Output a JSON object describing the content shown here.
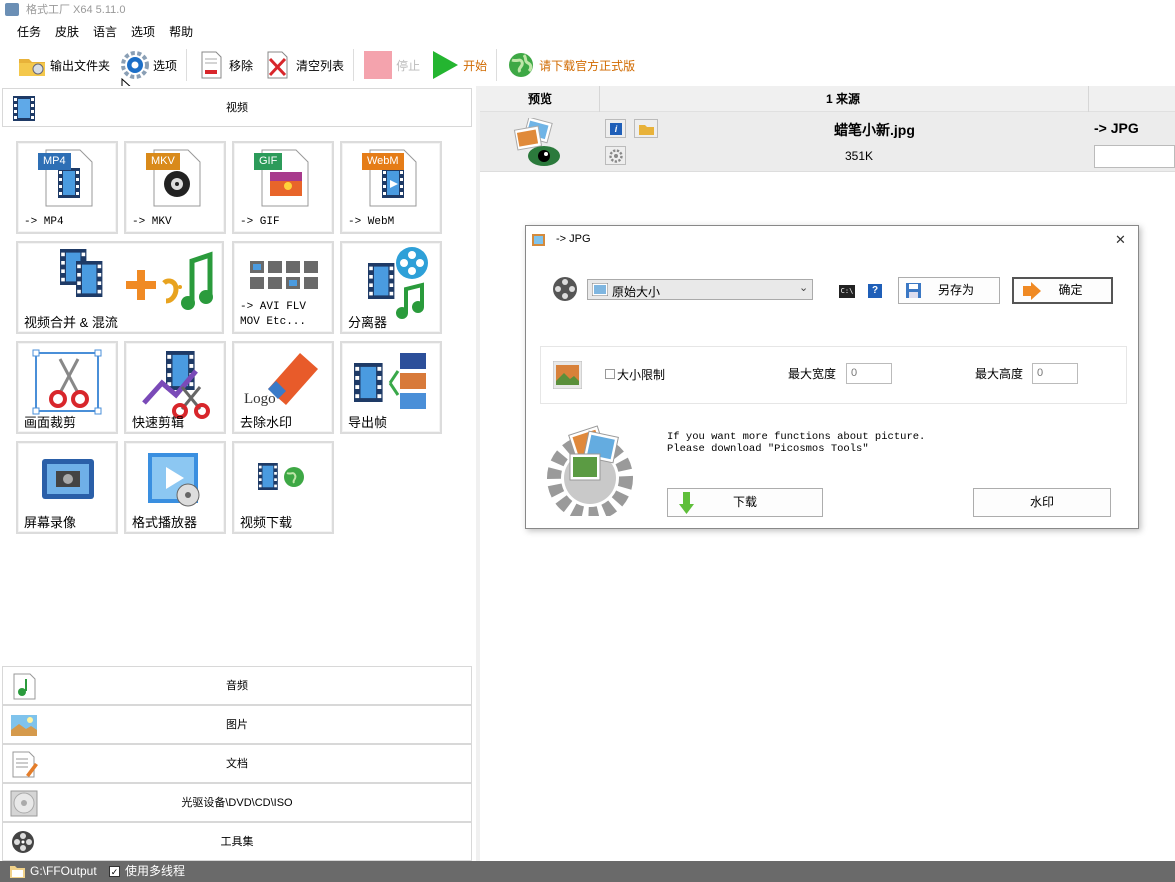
{
  "app": {
    "title": "格式工厂 X64 5.11.0"
  },
  "menu": [
    "任务",
    "皮肤",
    "语言",
    "选项",
    "帮助"
  ],
  "toolbar": {
    "output_folder": "输出文件夹",
    "options": "选项",
    "remove": "移除",
    "clear_list": "清空列表",
    "stop": "停止",
    "start": "开始",
    "download_official": "请下载官方正式版"
  },
  "categories": {
    "video": "视频",
    "audio": "音频",
    "image": "图片",
    "document": "文档",
    "rom": "光驱设备\\DVD\\CD\\ISO",
    "toolbox": "工具集"
  },
  "tiles": [
    {
      "id": "mp4",
      "label": "-> MP4",
      "badge": "MP4",
      "badge_color": "#2e6fb5",
      "mono": true
    },
    {
      "id": "mkv",
      "label": "-> MKV",
      "badge": "MKV",
      "badge_color": "#d98a1a",
      "mono": true
    },
    {
      "id": "gif",
      "label": "-> GIF",
      "badge": "GIF",
      "badge_color": "#2c9b5a",
      "mono": true
    },
    {
      "id": "webm",
      "label": "-> WebM",
      "badge": "WebM",
      "badge_color": "#e57c17",
      "mono": true
    },
    {
      "id": "merge",
      "label": "视频合并 & 混流",
      "mono": false
    },
    {
      "id": "avi",
      "label": "-> AVI FLV\nMOV Etc...",
      "mono": true
    },
    {
      "id": "splitter",
      "label": "分离器",
      "mono": false
    },
    {
      "id": "crop",
      "label": "画面裁剪",
      "mono": false
    },
    {
      "id": "quickcut",
      "label": "快速剪辑",
      "mono": false
    },
    {
      "id": "watermark",
      "label": "去除水印",
      "logo_text": "Logo",
      "mono": false
    },
    {
      "id": "frames",
      "label": "导出帧",
      "mono": false
    },
    {
      "id": "screenrec",
      "label": "屏幕录像",
      "mono": false
    },
    {
      "id": "player",
      "label": "格式播放器",
      "mono": false
    },
    {
      "id": "vdownload",
      "label": "视频下载",
      "mono": false
    }
  ],
  "list": {
    "col_preview": "预览",
    "col_source": "1 来源",
    "col_target": "-> JPG",
    "file_name": "蜡笔小新.jpg",
    "file_size": "351K",
    "file_target": "-> JPG"
  },
  "dialog": {
    "title": "-> JPG",
    "preset": "原始大小",
    "save_as": "另存为",
    "ok": "确定",
    "size_limit": "大小限制",
    "max_width_label": "最大宽度",
    "max_width": "0",
    "max_height_label": "最大高度",
    "max_height": "0",
    "promo_line1": "If you want more functions about picture.",
    "promo_line2": "Please download \"Picosmos Tools\"",
    "download": "下载",
    "watermark": "水印"
  },
  "status": {
    "output_path": "G:\\FFOutput",
    "multithread": "使用多线程"
  }
}
